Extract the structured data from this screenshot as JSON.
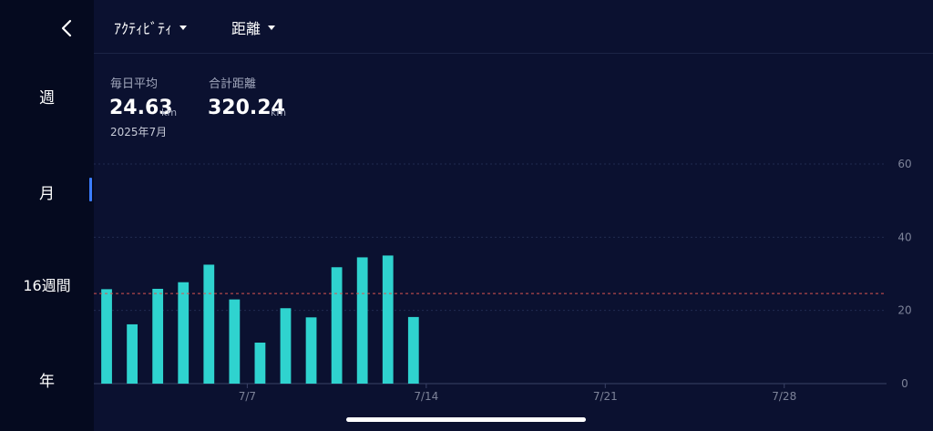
{
  "nav": {
    "periods": [
      {
        "label": "週",
        "selected": false
      },
      {
        "label": "月",
        "selected": true
      },
      {
        "label": "16週間",
        "selected": false
      },
      {
        "label": "年",
        "selected": false
      }
    ],
    "accent_color": "#3b7dff"
  },
  "header": {
    "activity_dropdown": "ｱｸﾃｨﾋﾞﾃｨ",
    "metric_dropdown": "距離"
  },
  "summary": {
    "daily_avg_label": "毎日平均",
    "daily_avg_value": "24.63",
    "daily_avg_unit": "km",
    "period_label": "2025年7月",
    "total_label": "合計距離",
    "total_value": "320.24",
    "total_unit": "km"
  },
  "chart_data": {
    "type": "bar",
    "x": [
      "7/1",
      "7/2",
      "7/3",
      "7/4",
      "7/5",
      "7/6",
      "7/7",
      "7/8",
      "7/9",
      "7/10",
      "7/11",
      "7/12",
      "7/13"
    ],
    "values": [
      25.8,
      16.2,
      25.9,
      27.7,
      32.5,
      23.0,
      11.2,
      20.6,
      18.1,
      31.8,
      34.5,
      35.0,
      18.2
    ],
    "x_axis_range": [
      "7/1",
      "7/31"
    ],
    "x_tick_labels": [
      "7/7",
      "7/14",
      "7/21",
      "7/28"
    ],
    "y_tick_labels": [
      "0",
      "20",
      "40",
      "60"
    ],
    "ylim": [
      0,
      60
    ],
    "average_line": 24.63,
    "grid": true,
    "bar_color": "#2fd3cf",
    "average_line_color": "#d9534f"
  }
}
